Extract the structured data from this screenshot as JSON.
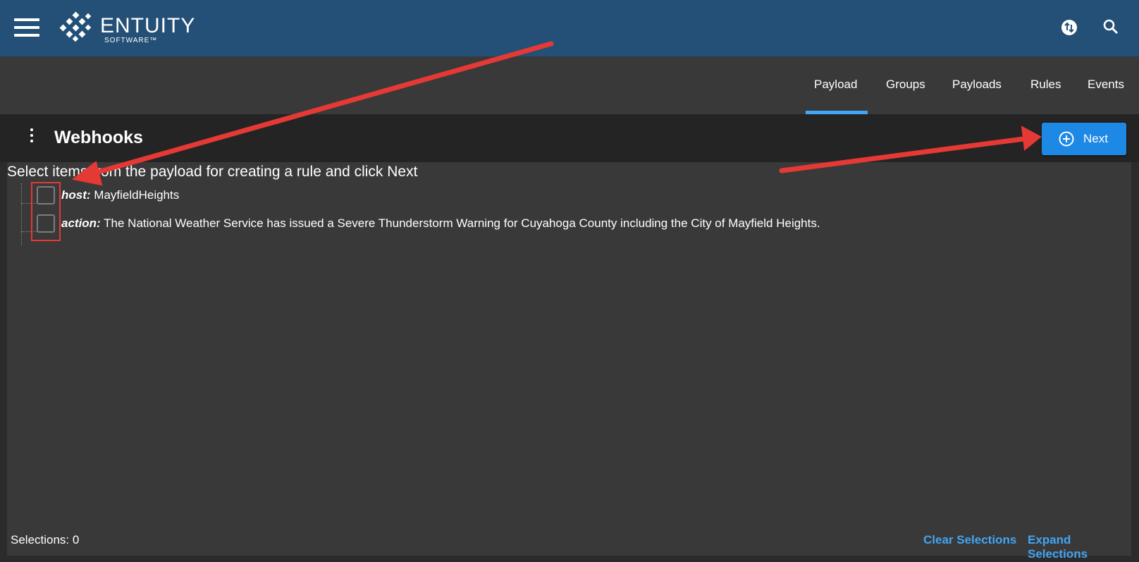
{
  "app": {
    "logo_text": "ENTUITY",
    "logo_sub": "SOFTWARE™"
  },
  "tabs": [
    {
      "label": "Payload",
      "active": true
    },
    {
      "label": "Groups",
      "active": false
    },
    {
      "label": "Payloads",
      "active": false
    },
    {
      "label": "Rules",
      "active": false
    },
    {
      "label": "Events",
      "active": false
    }
  ],
  "header": {
    "title": "Webhooks",
    "next_label": "Next"
  },
  "content": {
    "instruction": "Select items from the payload for creating a rule and click Next",
    "items": [
      {
        "key": "host:",
        "value": "MayfieldHeights",
        "checked": false
      },
      {
        "key": "action:",
        "value": "The National Weather Service has issued a Severe Thunderstorm Warning for Cuyahoga County including the City of Mayfield Heights.",
        "checked": false
      }
    ]
  },
  "footer": {
    "selections_label": "Selections:",
    "selections_count": "0",
    "clear_label": "Clear Selections",
    "expand_label": "Expand Selections"
  },
  "colors": {
    "topbar": "#245077",
    "accent": "#1e88e5",
    "link": "#42a5f5",
    "annotation": "#e53935"
  }
}
